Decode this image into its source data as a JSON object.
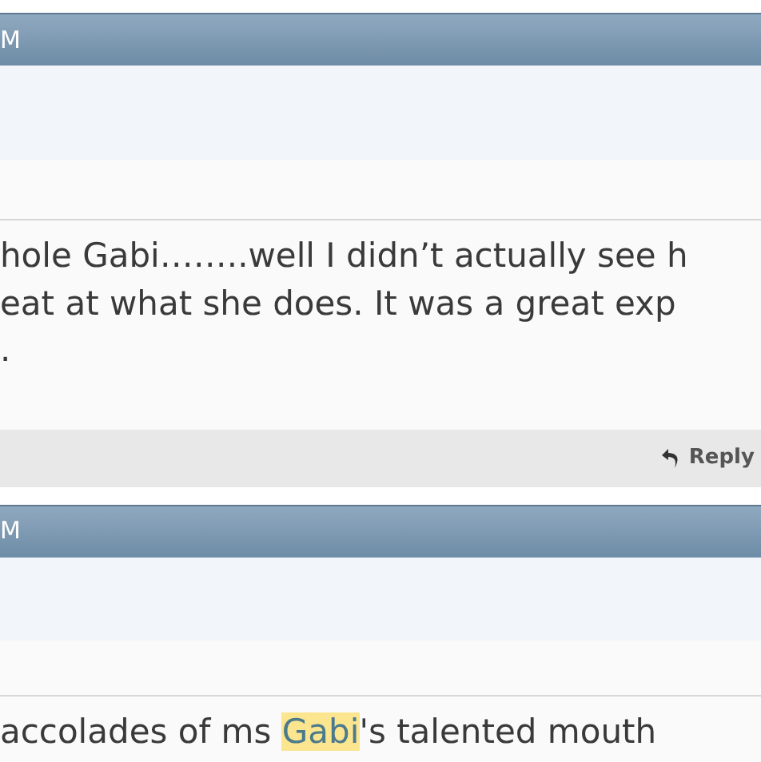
{
  "posts": [
    {
      "header": "M",
      "lines": [
        [
          {
            "text": "hole Gabi……..well I didn’t actually see h",
            "highlighted": false
          }
        ],
        [
          {
            "text": "eat at what she does. It was a great exp",
            "highlighted": false
          }
        ],
        [
          {
            "text": ".",
            "highlighted": false
          }
        ]
      ],
      "reply": "Reply"
    },
    {
      "header": "M",
      "lines": [
        [
          {
            "text": "accolades of ms ",
            "highlighted": false
          },
          {
            "text": "Gabi",
            "highlighted": true
          },
          {
            "text": "'s talented mouth",
            "highlighted": false
          }
        ]
      ]
    }
  ]
}
